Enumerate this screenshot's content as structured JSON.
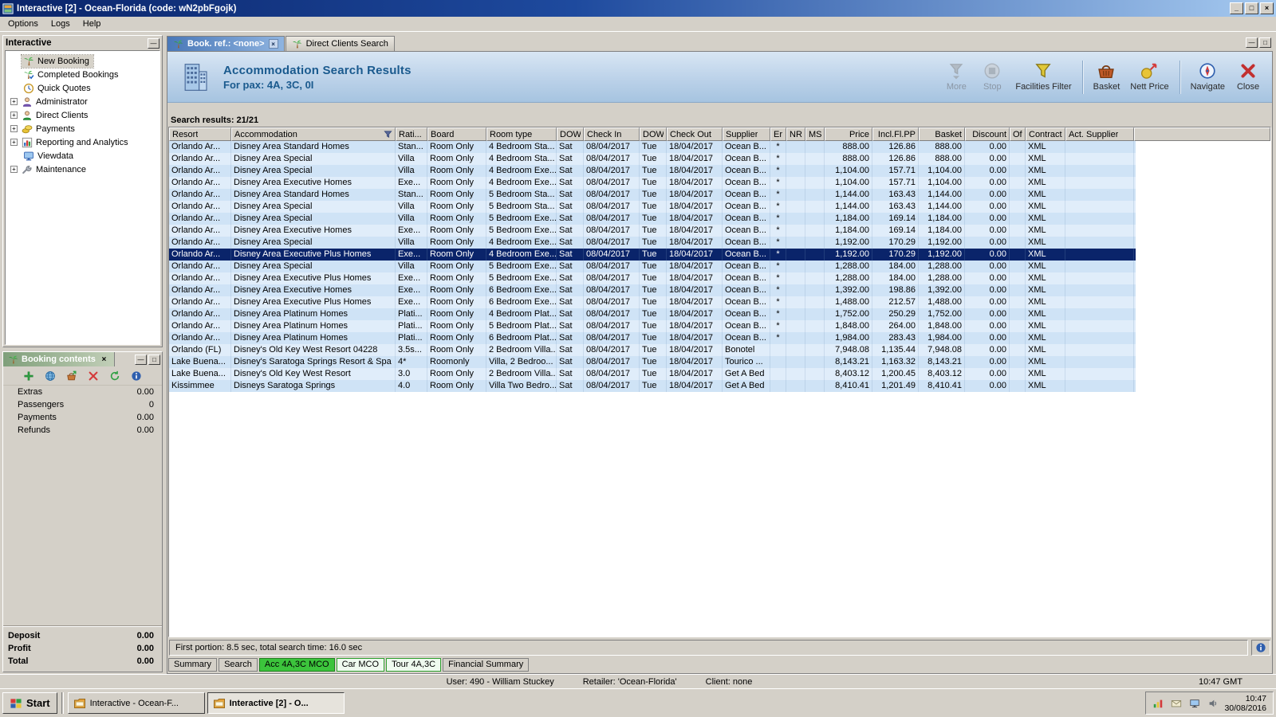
{
  "window": {
    "title": "Interactive [2] - Ocean-Florida (code: wN2pbFgojk)",
    "menu_items": [
      "Options",
      "Logs",
      "Help"
    ],
    "controls": {
      "minimize": "_",
      "maximize": "□",
      "close": "×"
    }
  },
  "sidebar": {
    "title": "Interactive",
    "items": [
      {
        "label": "New Booking",
        "icon": "palm-tree-icon",
        "expandable": false,
        "selected": true
      },
      {
        "label": "Completed Bookings",
        "icon": "completed-bookings-icon",
        "expandable": false,
        "selected": false
      },
      {
        "label": "Quick Quotes",
        "icon": "clock-icon",
        "expandable": false,
        "selected": false
      },
      {
        "label": "Administrator",
        "icon": "person-icon",
        "expandable": true,
        "selected": false
      },
      {
        "label": "Direct Clients",
        "icon": "person-green-icon",
        "expandable": true,
        "selected": false
      },
      {
        "label": "Payments",
        "icon": "coins-icon",
        "expandable": true,
        "selected": false
      },
      {
        "label": "Reporting and Analytics",
        "icon": "chart-icon",
        "expandable": true,
        "selected": false
      },
      {
        "label": "Viewdata",
        "icon": "monitor-icon",
        "expandable": false,
        "selected": false
      },
      {
        "label": "Maintenance",
        "icon": "wrench-icon",
        "expandable": true,
        "selected": false
      }
    ]
  },
  "booking_contents": {
    "title": "Booking contents",
    "toolbar_icons": [
      "add-icon",
      "globe-icon",
      "basket-add-icon",
      "delete-icon",
      "refresh-icon",
      "info-icon"
    ],
    "rows": [
      {
        "label": "Extras",
        "value": "0.00"
      },
      {
        "label": "Passengers",
        "value": "0"
      },
      {
        "label": "Payments",
        "value": "0.00"
      },
      {
        "label": "Refunds",
        "value": "0.00"
      }
    ],
    "totals": [
      {
        "label": "Deposit",
        "value": "0.00"
      },
      {
        "label": "Profit",
        "value": "0.00"
      },
      {
        "label": "Total",
        "value": "0.00"
      }
    ]
  },
  "doc_tabs": [
    {
      "label": "Book. ref.: <none>",
      "active": true,
      "closable": true
    },
    {
      "label": "Direct Clients Search",
      "active": false,
      "closable": false
    }
  ],
  "banner": {
    "title": "Accommodation Search Results",
    "subtitle": "For pax: 4A, 3C, 0I",
    "buttons": [
      {
        "label": "More",
        "icon": "more-icon",
        "disabled": true,
        "sep_before": false
      },
      {
        "label": "Stop",
        "icon": "stop-icon",
        "disabled": true,
        "sep_before": false
      },
      {
        "label": "Facilities Filter",
        "icon": "facilities-filter-icon",
        "disabled": false,
        "sep_before": false
      },
      {
        "label": "Basket",
        "icon": "basket-icon",
        "disabled": false,
        "sep_before": true
      },
      {
        "label": "Nett Price",
        "icon": "nett-price-icon",
        "disabled": false,
        "sep_before": false
      },
      {
        "label": "Navigate",
        "icon": "navigate-icon",
        "disabled": false,
        "sep_before": true
      },
      {
        "label": "Close",
        "icon": "close-x-icon",
        "disabled": false,
        "sep_before": false
      }
    ]
  },
  "results": {
    "count_label": "Search results: 21/21",
    "columns": [
      "Resort",
      "Accommodation",
      "Rati...",
      "Board",
      "Room type",
      "DOW",
      "Check In",
      "DOW",
      "Check Out",
      "Supplier",
      "Er",
      "NR",
      "MS",
      "Price",
      "Incl.Fl.PP",
      "Basket",
      "Discount",
      "Of",
      "Contract",
      "Act. Supplier"
    ],
    "filter_column_index": 1,
    "selected_index": 9,
    "footer_text": "First portion: 8.5 sec, total search time: 16.0 sec",
    "rows": [
      [
        "Orlando Ar...",
        "Disney Area Standard Homes",
        "Stan...",
        "Room Only",
        "4 Bedroom Sta...",
        "Sat",
        "08/04/2017",
        "Tue",
        "18/04/2017",
        "Ocean B...",
        "*",
        "",
        "",
        "888.00",
        "126.86",
        "888.00",
        "0.00",
        "",
        "XML",
        ""
      ],
      [
        "Orlando Ar...",
        "Disney Area Special",
        "Villa",
        "Room Only",
        "4 Bedroom Sta...",
        "Sat",
        "08/04/2017",
        "Tue",
        "18/04/2017",
        "Ocean B...",
        "*",
        "",
        "",
        "888.00",
        "126.86",
        "888.00",
        "0.00",
        "",
        "XML",
        ""
      ],
      [
        "Orlando Ar...",
        "Disney Area Special",
        "Villa",
        "Room Only",
        "4 Bedroom Exe...",
        "Sat",
        "08/04/2017",
        "Tue",
        "18/04/2017",
        "Ocean B...",
        "*",
        "",
        "",
        "1,104.00",
        "157.71",
        "1,104.00",
        "0.00",
        "",
        "XML",
        ""
      ],
      [
        "Orlando Ar...",
        "Disney Area Executive Homes",
        "Exe...",
        "Room Only",
        "4 Bedroom Exe...",
        "Sat",
        "08/04/2017",
        "Tue",
        "18/04/2017",
        "Ocean B...",
        "*",
        "",
        "",
        "1,104.00",
        "157.71",
        "1,104.00",
        "0.00",
        "",
        "XML",
        ""
      ],
      [
        "Orlando Ar...",
        "Disney Area Standard Homes",
        "Stan...",
        "Room Only",
        "5 Bedroom Sta...",
        "Sat",
        "08/04/2017",
        "Tue",
        "18/04/2017",
        "Ocean B...",
        "*",
        "",
        "",
        "1,144.00",
        "163.43",
        "1,144.00",
        "0.00",
        "",
        "XML",
        ""
      ],
      [
        "Orlando Ar...",
        "Disney Area Special",
        "Villa",
        "Room Only",
        "5 Bedroom Sta...",
        "Sat",
        "08/04/2017",
        "Tue",
        "18/04/2017",
        "Ocean B...",
        "*",
        "",
        "",
        "1,144.00",
        "163.43",
        "1,144.00",
        "0.00",
        "",
        "XML",
        ""
      ],
      [
        "Orlando Ar...",
        "Disney Area Special",
        "Villa",
        "Room Only",
        "5 Bedroom Exe...",
        "Sat",
        "08/04/2017",
        "Tue",
        "18/04/2017",
        "Ocean B...",
        "*",
        "",
        "",
        "1,184.00",
        "169.14",
        "1,184.00",
        "0.00",
        "",
        "XML",
        ""
      ],
      [
        "Orlando Ar...",
        "Disney Area Executive Homes",
        "Exe...",
        "Room Only",
        "5 Bedroom Exe...",
        "Sat",
        "08/04/2017",
        "Tue",
        "18/04/2017",
        "Ocean B...",
        "*",
        "",
        "",
        "1,184.00",
        "169.14",
        "1,184.00",
        "0.00",
        "",
        "XML",
        ""
      ],
      [
        "Orlando Ar...",
        "Disney Area Special",
        "Villa",
        "Room Only",
        "4 Bedroom Exe...",
        "Sat",
        "08/04/2017",
        "Tue",
        "18/04/2017",
        "Ocean B...",
        "*",
        "",
        "",
        "1,192.00",
        "170.29",
        "1,192.00",
        "0.00",
        "",
        "XML",
        ""
      ],
      [
        "Orlando Ar...",
        "Disney Area Executive Plus Homes",
        "Exe...",
        "Room Only",
        "4 Bedroom Exe...",
        "Sat",
        "08/04/2017",
        "Tue",
        "18/04/2017",
        "Ocean B...",
        "*",
        "",
        "",
        "1,192.00",
        "170.29",
        "1,192.00",
        "0.00",
        "",
        "XML",
        ""
      ],
      [
        "Orlando Ar...",
        "Disney Area Special",
        "Villa",
        "Room Only",
        "5 Bedroom Exe...",
        "Sat",
        "08/04/2017",
        "Tue",
        "18/04/2017",
        "Ocean B...",
        "*",
        "",
        "",
        "1,288.00",
        "184.00",
        "1,288.00",
        "0.00",
        "",
        "XML",
        ""
      ],
      [
        "Orlando Ar...",
        "Disney Area Executive Plus Homes",
        "Exe...",
        "Room Only",
        "5 Bedroom Exe...",
        "Sat",
        "08/04/2017",
        "Tue",
        "18/04/2017",
        "Ocean B...",
        "*",
        "",
        "",
        "1,288.00",
        "184.00",
        "1,288.00",
        "0.00",
        "",
        "XML",
        ""
      ],
      [
        "Orlando Ar...",
        "Disney Area Executive Homes",
        "Exe...",
        "Room Only",
        "6 Bedroom Exe...",
        "Sat",
        "08/04/2017",
        "Tue",
        "18/04/2017",
        "Ocean B...",
        "*",
        "",
        "",
        "1,392.00",
        "198.86",
        "1,392.00",
        "0.00",
        "",
        "XML",
        ""
      ],
      [
        "Orlando Ar...",
        "Disney Area Executive Plus Homes",
        "Exe...",
        "Room Only",
        "6 Bedroom Exe...",
        "Sat",
        "08/04/2017",
        "Tue",
        "18/04/2017",
        "Ocean B...",
        "*",
        "",
        "",
        "1,488.00",
        "212.57",
        "1,488.00",
        "0.00",
        "",
        "XML",
        ""
      ],
      [
        "Orlando Ar...",
        "Disney Area Platinum Homes",
        "Plati...",
        "Room Only",
        "4 Bedroom Plat...",
        "Sat",
        "08/04/2017",
        "Tue",
        "18/04/2017",
        "Ocean B...",
        "*",
        "",
        "",
        "1,752.00",
        "250.29",
        "1,752.00",
        "0.00",
        "",
        "XML",
        ""
      ],
      [
        "Orlando Ar...",
        "Disney Area Platinum Homes",
        "Plati...",
        "Room Only",
        "5 Bedroom Plat...",
        "Sat",
        "08/04/2017",
        "Tue",
        "18/04/2017",
        "Ocean B...",
        "*",
        "",
        "",
        "1,848.00",
        "264.00",
        "1,848.00",
        "0.00",
        "",
        "XML",
        ""
      ],
      [
        "Orlando Ar...",
        "Disney Area Platinum Homes",
        "Plati...",
        "Room Only",
        "6 Bedroom Plat...",
        "Sat",
        "08/04/2017",
        "Tue",
        "18/04/2017",
        "Ocean B...",
        "*",
        "",
        "",
        "1,984.00",
        "283.43",
        "1,984.00",
        "0.00",
        "",
        "XML",
        ""
      ],
      [
        "Orlando (FL)",
        "Disney's Old Key West Resort 04228",
        "3.5s...",
        "Room Only",
        "2 Bedroom Villa...",
        "Sat",
        "08/04/2017",
        "Tue",
        "18/04/2017",
        "Bonotel",
        "",
        "",
        "",
        "7,948.08",
        "1,135.44",
        "7,948.08",
        "0.00",
        "",
        "XML",
        ""
      ],
      [
        "Lake Buena...",
        "Disney's Saratoga Springs Resort & Spa",
        "4*",
        "Roomonly",
        "Villa, 2 Bedroo...",
        "Sat",
        "08/04/2017",
        "Tue",
        "18/04/2017",
        "Tourico ...",
        "",
        "",
        "",
        "8,143.21",
        "1,163.32",
        "8,143.21",
        "0.00",
        "",
        "XML",
        ""
      ],
      [
        "Lake Buena...",
        "Disney's Old Key West Resort",
        "3.0",
        "Room Only",
        "2 Bedroom Villa...",
        "Sat",
        "08/04/2017",
        "Tue",
        "18/04/2017",
        "Get A Bed",
        "",
        "",
        "",
        "8,403.12",
        "1,200.45",
        "8,403.12",
        "0.00",
        "",
        "XML",
        ""
      ],
      [
        "Kissimmee",
        "Disneys Saratoga Springs",
        "4.0",
        "Room Only",
        "Villa Two Bedro...",
        "Sat",
        "08/04/2017",
        "Tue",
        "18/04/2017",
        "Get A Bed",
        "",
        "",
        "",
        "8,410.41",
        "1,201.49",
        "8,410.41",
        "0.00",
        "",
        "XML",
        ""
      ]
    ]
  },
  "bottom_tabs": [
    {
      "label": "Summary",
      "style": "plain"
    },
    {
      "label": "Search",
      "style": "plain"
    },
    {
      "label": "Acc 4A,3C MCO",
      "style": "green-solid"
    },
    {
      "label": "Car MCO",
      "style": "green-outline"
    },
    {
      "label": "Tour 4A,3C",
      "style": "green-outline"
    },
    {
      "label": "Financial Summary",
      "style": "plain"
    }
  ],
  "status_bar": {
    "user": "User: 490 - William Stuckey",
    "retailer": "Retailer: 'Ocean-Florida'",
    "client": "Client: none",
    "time": "10:47 GMT"
  },
  "taskbar": {
    "start_label": "Start",
    "windows": [
      {
        "label": "Interactive - Ocean-F...",
        "active": false
      },
      {
        "label": "Interactive [2] - O...",
        "active": true
      }
    ],
    "tray_icons": [
      "tray-chart-icon",
      "tray-mail-icon",
      "tray-display-icon",
      "tray-audio-icon"
    ],
    "clock": {
      "time": "10:47",
      "date": "30/08/2016"
    }
  }
}
